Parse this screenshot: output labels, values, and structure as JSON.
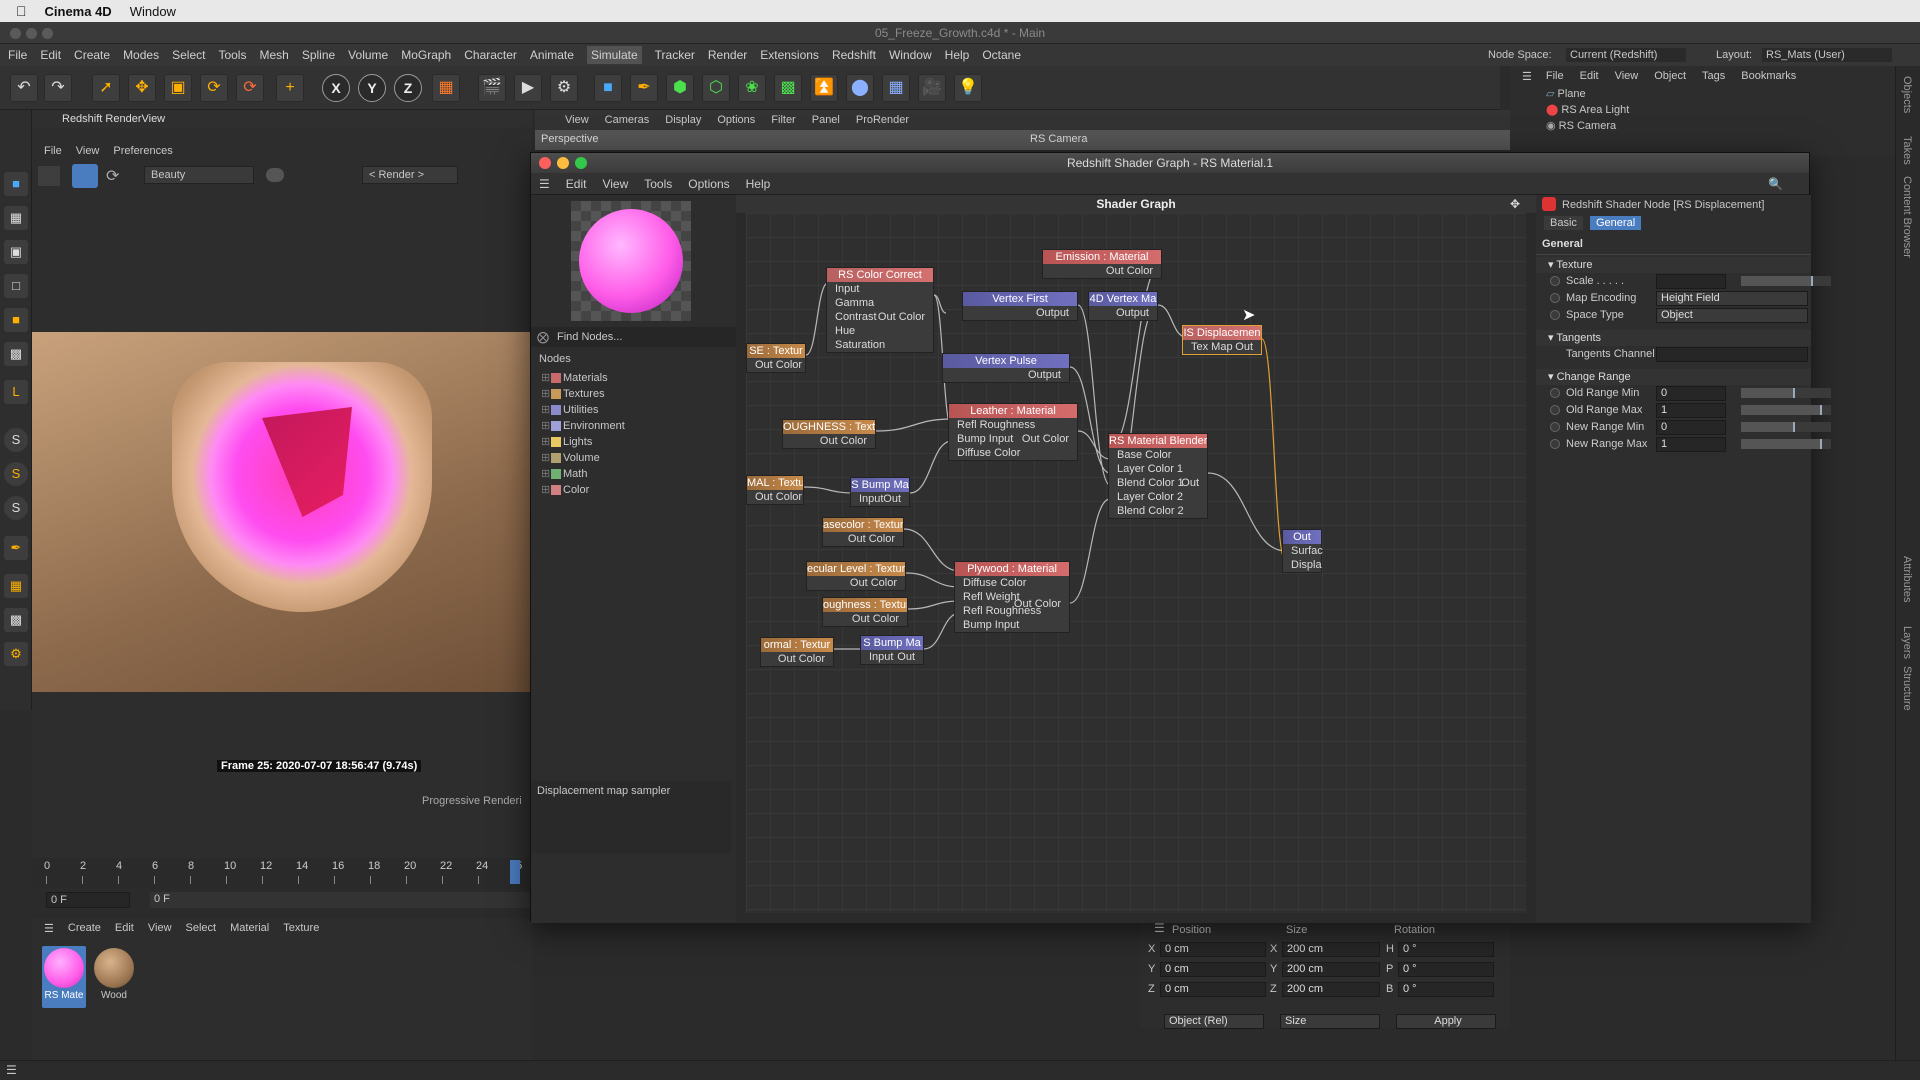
{
  "mac": {
    "app": "Cinema 4D",
    "window_menu": "Window"
  },
  "window_title": "05_Freeze_Growth.c4d * - Main",
  "main_menu": [
    "File",
    "Edit",
    "Create",
    "Modes",
    "Select",
    "Tools",
    "Mesh",
    "Spline",
    "Volume",
    "MoGraph",
    "Character",
    "Animate",
    "Simulate",
    "Tracker",
    "Render",
    "Extensions",
    "Redshift",
    "Window",
    "Help",
    "Octane"
  ],
  "node_space": {
    "label": "Node Space:",
    "value": "Current (Redshift)"
  },
  "layout": {
    "label": "Layout:",
    "value": "RS_Mats (User)"
  },
  "viewport": {
    "menu": [
      "View",
      "Cameras",
      "Display",
      "Options",
      "Filter",
      "Panel",
      "ProRender"
    ],
    "name": "Perspective",
    "camera": "RS Camera"
  },
  "objects": {
    "menu": [
      "File",
      "Edit",
      "View",
      "Object",
      "Tags",
      "Bookmarks"
    ],
    "items": [
      "Plane",
      "RS Area Light",
      "RS Camera"
    ]
  },
  "renderview": {
    "title": "Redshift RenderView",
    "menu": [
      "File",
      "View",
      "Preferences"
    ],
    "aov": "Beauty",
    "render_mode": "< Render >",
    "frame_info": "Frame  25:  2020-07-07  18:56:47  (9.74s)",
    "progressive": "Progressive Renderi"
  },
  "timeline": {
    "ticks": [
      "0",
      "2",
      "4",
      "6",
      "8",
      "10",
      "12",
      "14",
      "16",
      "18",
      "20",
      "22",
      "24",
      "25"
    ],
    "start": "0 F",
    "end": "0 F"
  },
  "matmgr": {
    "menu": [
      "Create",
      "Edit",
      "View",
      "Select",
      "Material",
      "Texture"
    ],
    "materials": [
      "RS Mate",
      "Wood"
    ]
  },
  "coords": {
    "headers": [
      "Position",
      "Size",
      "Rotation"
    ],
    "rows": [
      {
        "axis": "X",
        "pos": "0 cm",
        "slabel": "X",
        "size": "200 cm",
        "rlabel": "H",
        "rot": "0 °"
      },
      {
        "axis": "Y",
        "pos": "0 cm",
        "slabel": "Y",
        "size": "200 cm",
        "rlabel": "P",
        "rot": "0 °"
      },
      {
        "axis": "Z",
        "pos": "0 cm",
        "slabel": "Z",
        "size": "200 cm",
        "rlabel": "B",
        "rot": "0 °"
      }
    ],
    "mode": "Object (Rel)",
    "size_mode": "Size",
    "apply": "Apply"
  },
  "shader_graph": {
    "title": "Redshift Shader Graph - RS Material.1",
    "menu": [
      "Edit",
      "View",
      "Tools",
      "Options",
      "Help"
    ],
    "find_nodes": "Find Nodes...",
    "nodes_header": "Nodes",
    "categories": [
      {
        "name": "Materials",
        "color": "#c96a6a"
      },
      {
        "name": "Textures",
        "color": "#c89a5a"
      },
      {
        "name": "Utilities",
        "color": "#8a8ac8"
      },
      {
        "name": "Environment",
        "color": "#a0a0d8"
      },
      {
        "name": "Lights",
        "color": "#e8c860"
      },
      {
        "name": "Volume",
        "color": "#b0a070"
      },
      {
        "name": "Math",
        "color": "#70b070"
      },
      {
        "name": "Color",
        "color": "#d08080"
      }
    ],
    "description": "Displacement map sampler",
    "canvas_title": "Shader Graph",
    "nodes": {
      "color_correct": {
        "title": "RS Color Correct",
        "rows": [
          "Input",
          "Gamma",
          "Contrast",
          "Hue",
          "Saturation"
        ],
        "out": "Out Color"
      },
      "emission": {
        "title": "Emission : Material",
        "out": "Out Color"
      },
      "vertex_first": {
        "title": "Vertex First",
        "out": "Output"
      },
      "vertex_ma": {
        "title": "4D Vertex Ma",
        "out": "Output"
      },
      "displacement": {
        "title": "IS Displacemen",
        "in": "Tex Map",
        "out": "Out"
      },
      "se_tex": {
        "title": "SE : Textur",
        "out": "Out Color"
      },
      "vertex_pulse": {
        "title": "Vertex Pulse",
        "out": "Output"
      },
      "leather": {
        "title": "Leather : Material",
        "rows": [
          "Refl Roughness",
          "Bump Input",
          "Diffuse Color"
        ],
        "out": "Out Color"
      },
      "roughness_tex": {
        "title": "OUGHNESS : Textu",
        "out": "Out Color"
      },
      "blender": {
        "title": "RS Material Blender",
        "rows": [
          "Base Color",
          "Layer Color 1",
          "Blend Color 1",
          "Layer Color 2",
          "Blend Color 2"
        ],
        "out": "Out"
      },
      "mal_tex": {
        "title": "MAL : Textur",
        "out": "Out Color"
      },
      "bump1": {
        "title": "S Bump Ma",
        "in": "Input",
        "out": "Out"
      },
      "basecolor_tex": {
        "title": "asecolor : Textur",
        "out": "Out Color"
      },
      "output": {
        "title": "Out",
        "rows": [
          "Surfac",
          "Displa"
        ]
      },
      "specular_tex": {
        "title": "ecular Level : Textur",
        "out": "Out Color"
      },
      "plywood": {
        "title": "Plywood : Material",
        "rows": [
          "Diffuse Color",
          "Refl Weight",
          "Refl Roughness",
          "Bump Input"
        ],
        "out": "Out Color"
      },
      "roughness2_tex": {
        "title": "oughness : Textur",
        "out": "Out Color"
      },
      "normal_tex": {
        "title": "ormal : Textur",
        "out": "Out Color"
      },
      "bump2": {
        "title": "S Bump Ma",
        "in": "Input",
        "out": "Out"
      }
    },
    "attributes": {
      "header": "Redshift Shader Node [RS Displacement]",
      "tabs": [
        "Basic",
        "General"
      ],
      "group": "General",
      "texture_section": "Texture",
      "scale_label": "Scale . . . . .",
      "map_encoding_label": "Map Encoding",
      "map_encoding": "Height Field",
      "space_type_label": "Space Type",
      "space_type": "Object",
      "tangents_section": "Tangents",
      "tangents_channel": "Tangents Channel",
      "change_range_section": "Change Range",
      "ranges": [
        {
          "label": "Old Range Min",
          "value": "0",
          "fill": 0.6
        },
        {
          "label": "Old Range Max",
          "value": "1",
          "fill": 0.9
        },
        {
          "label": "New Range Min",
          "value": "0",
          "fill": 0.6
        },
        {
          "label": "New Range Max",
          "value": "1",
          "fill": 0.9
        }
      ]
    }
  },
  "side_tabs": [
    "Objects",
    "Takes",
    "Content Browser",
    "Attributes",
    "Layers",
    "Structure"
  ]
}
